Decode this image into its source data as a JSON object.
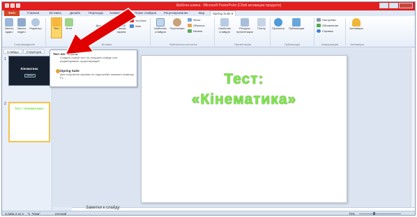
{
  "window": {
    "title": "Шаблон-шапка - Microsoft PowerPoint (Сбой активации продукта)"
  },
  "tabs": {
    "file": "Файл",
    "items": [
      "Главная",
      "Вставка",
      "Дизайн",
      "Переходы",
      "Анимация",
      "Показ слайдов",
      "Рецензирование",
      "Вид",
      "iSpring Suite 9"
    ],
    "active": "iSpring Suite 9"
  },
  "ribbon": {
    "record_audio": "Запись аудио",
    "record_video": "Запись видео",
    "editor": "Редактор",
    "test": "Тест",
    "interaction": "Инте",
    "simulator": "Диалоговый тренажер",
    "screen_record": "Запись экрана",
    "youtube": "YouTube",
    "web": "Web",
    "slide_templates": "Шаблоны слайдов",
    "characters": "Персонажи",
    "backgrounds": "Фоны",
    "objects": "Объекты",
    "icons": "Иконки",
    "properties": "Свойства слайдов",
    "resources": "Ресурсы презентации",
    "player": "Плеер",
    "preview": "Просмотр",
    "publish": "Публикация",
    "settings": "Настройки",
    "updates": "Обновления",
    "help": "Справка",
    "activation": "Активация",
    "groups": [
      "Сопровождение",
      "Вставка",
      "Библиотека контента",
      "Презентация",
      "Публикация",
      "Информация",
      "Активация"
    ]
  },
  "panel": {
    "tabs": [
      "Слайды",
      "Структура"
    ],
    "slide1_title": "Кінематика",
    "slide1_button": "начать",
    "slide2_title": "Тест: «Кінематика»"
  },
  "dropdown": {
    "item1_head": "Тест или анкета",
    "item1_desc": "Создать новый тест на текущем слайде или редактировать существующий",
    "item2_head": "iSpring Suite",
    "item2_desc": "Для получения справки по надстройке нажмите клавишу F1."
  },
  "slide": {
    "title_line1": "Тест:",
    "title_line2": "«Кінематика»"
  },
  "notes": {
    "placeholder": "Заметки к слайду"
  },
  "status": {
    "slide_counter": "Слайд 2 из 2",
    "theme": "\"1_Тема\"",
    "language": "русский",
    "zoom": "70%"
  },
  "colors": {
    "titlebar": "#e21e1e",
    "file_tab": "#d24726",
    "slide_title_green": "#7ee84a",
    "selected_thumb_border": "#f3c34b",
    "annotation_arrow": "#e00000"
  }
}
